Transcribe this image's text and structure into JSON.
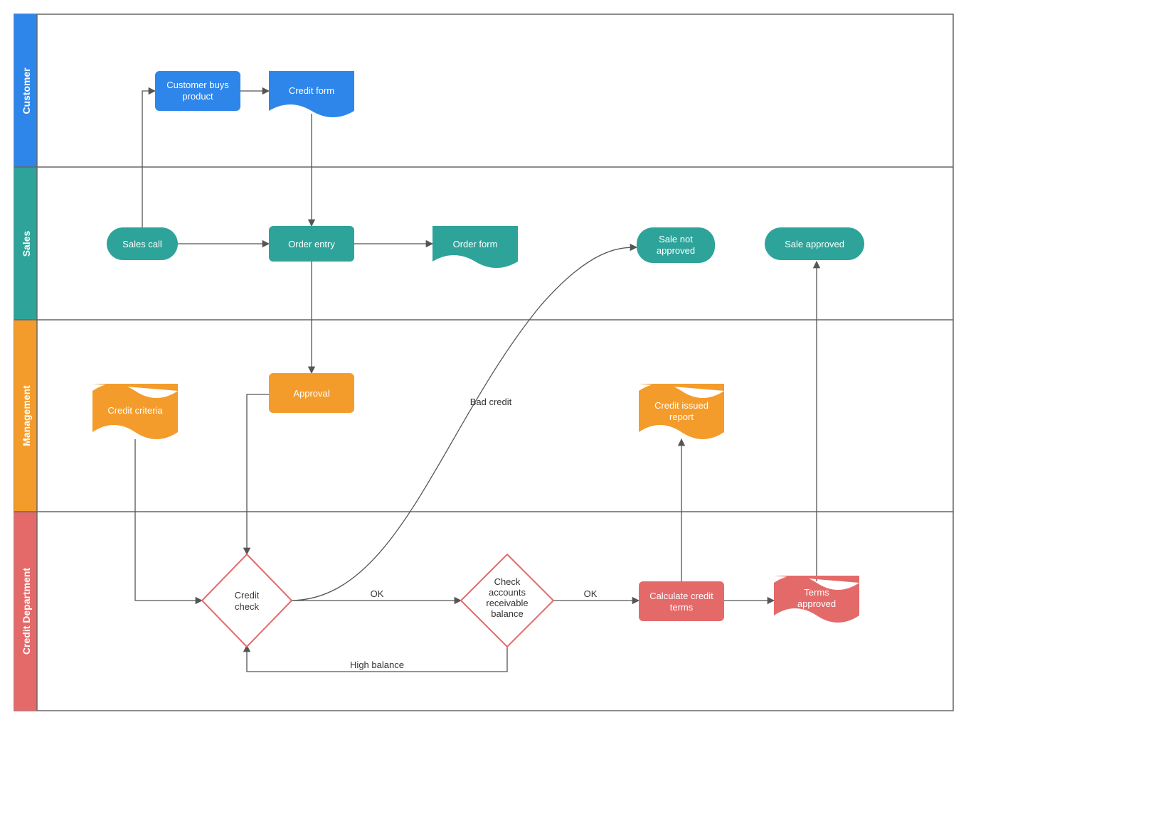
{
  "lanes": {
    "customer": "Customer",
    "sales": "Sales",
    "management": "Management",
    "credit": "Credit Department"
  },
  "nodes": {
    "customer_buys": "Customer buys product",
    "credit_form": "Credit form",
    "sales_call": "Sales call",
    "order_entry": "Order entry",
    "order_form": "Order form",
    "sale_not_approved": "Sale not approved",
    "sale_approved": "Sale approved",
    "credit_criteria": "Credit criteria",
    "approval": "Approval",
    "credit_issued_report": "Credit issued report",
    "credit_check": "Credit check",
    "check_accounts": "Check accounts receivable balance",
    "calculate_terms": "Calculate credit terms",
    "terms_approved": "Terms approved"
  },
  "edgeLabels": {
    "bad_credit": "Bad credit",
    "ok1": "OK",
    "ok2": "OK",
    "high_balance": "High balance"
  },
  "colors": {
    "customer": "#2E86EB",
    "sales": "#2EA39A",
    "management": "#F39C2B",
    "credit": "#E46A6A",
    "border": "#666"
  }
}
